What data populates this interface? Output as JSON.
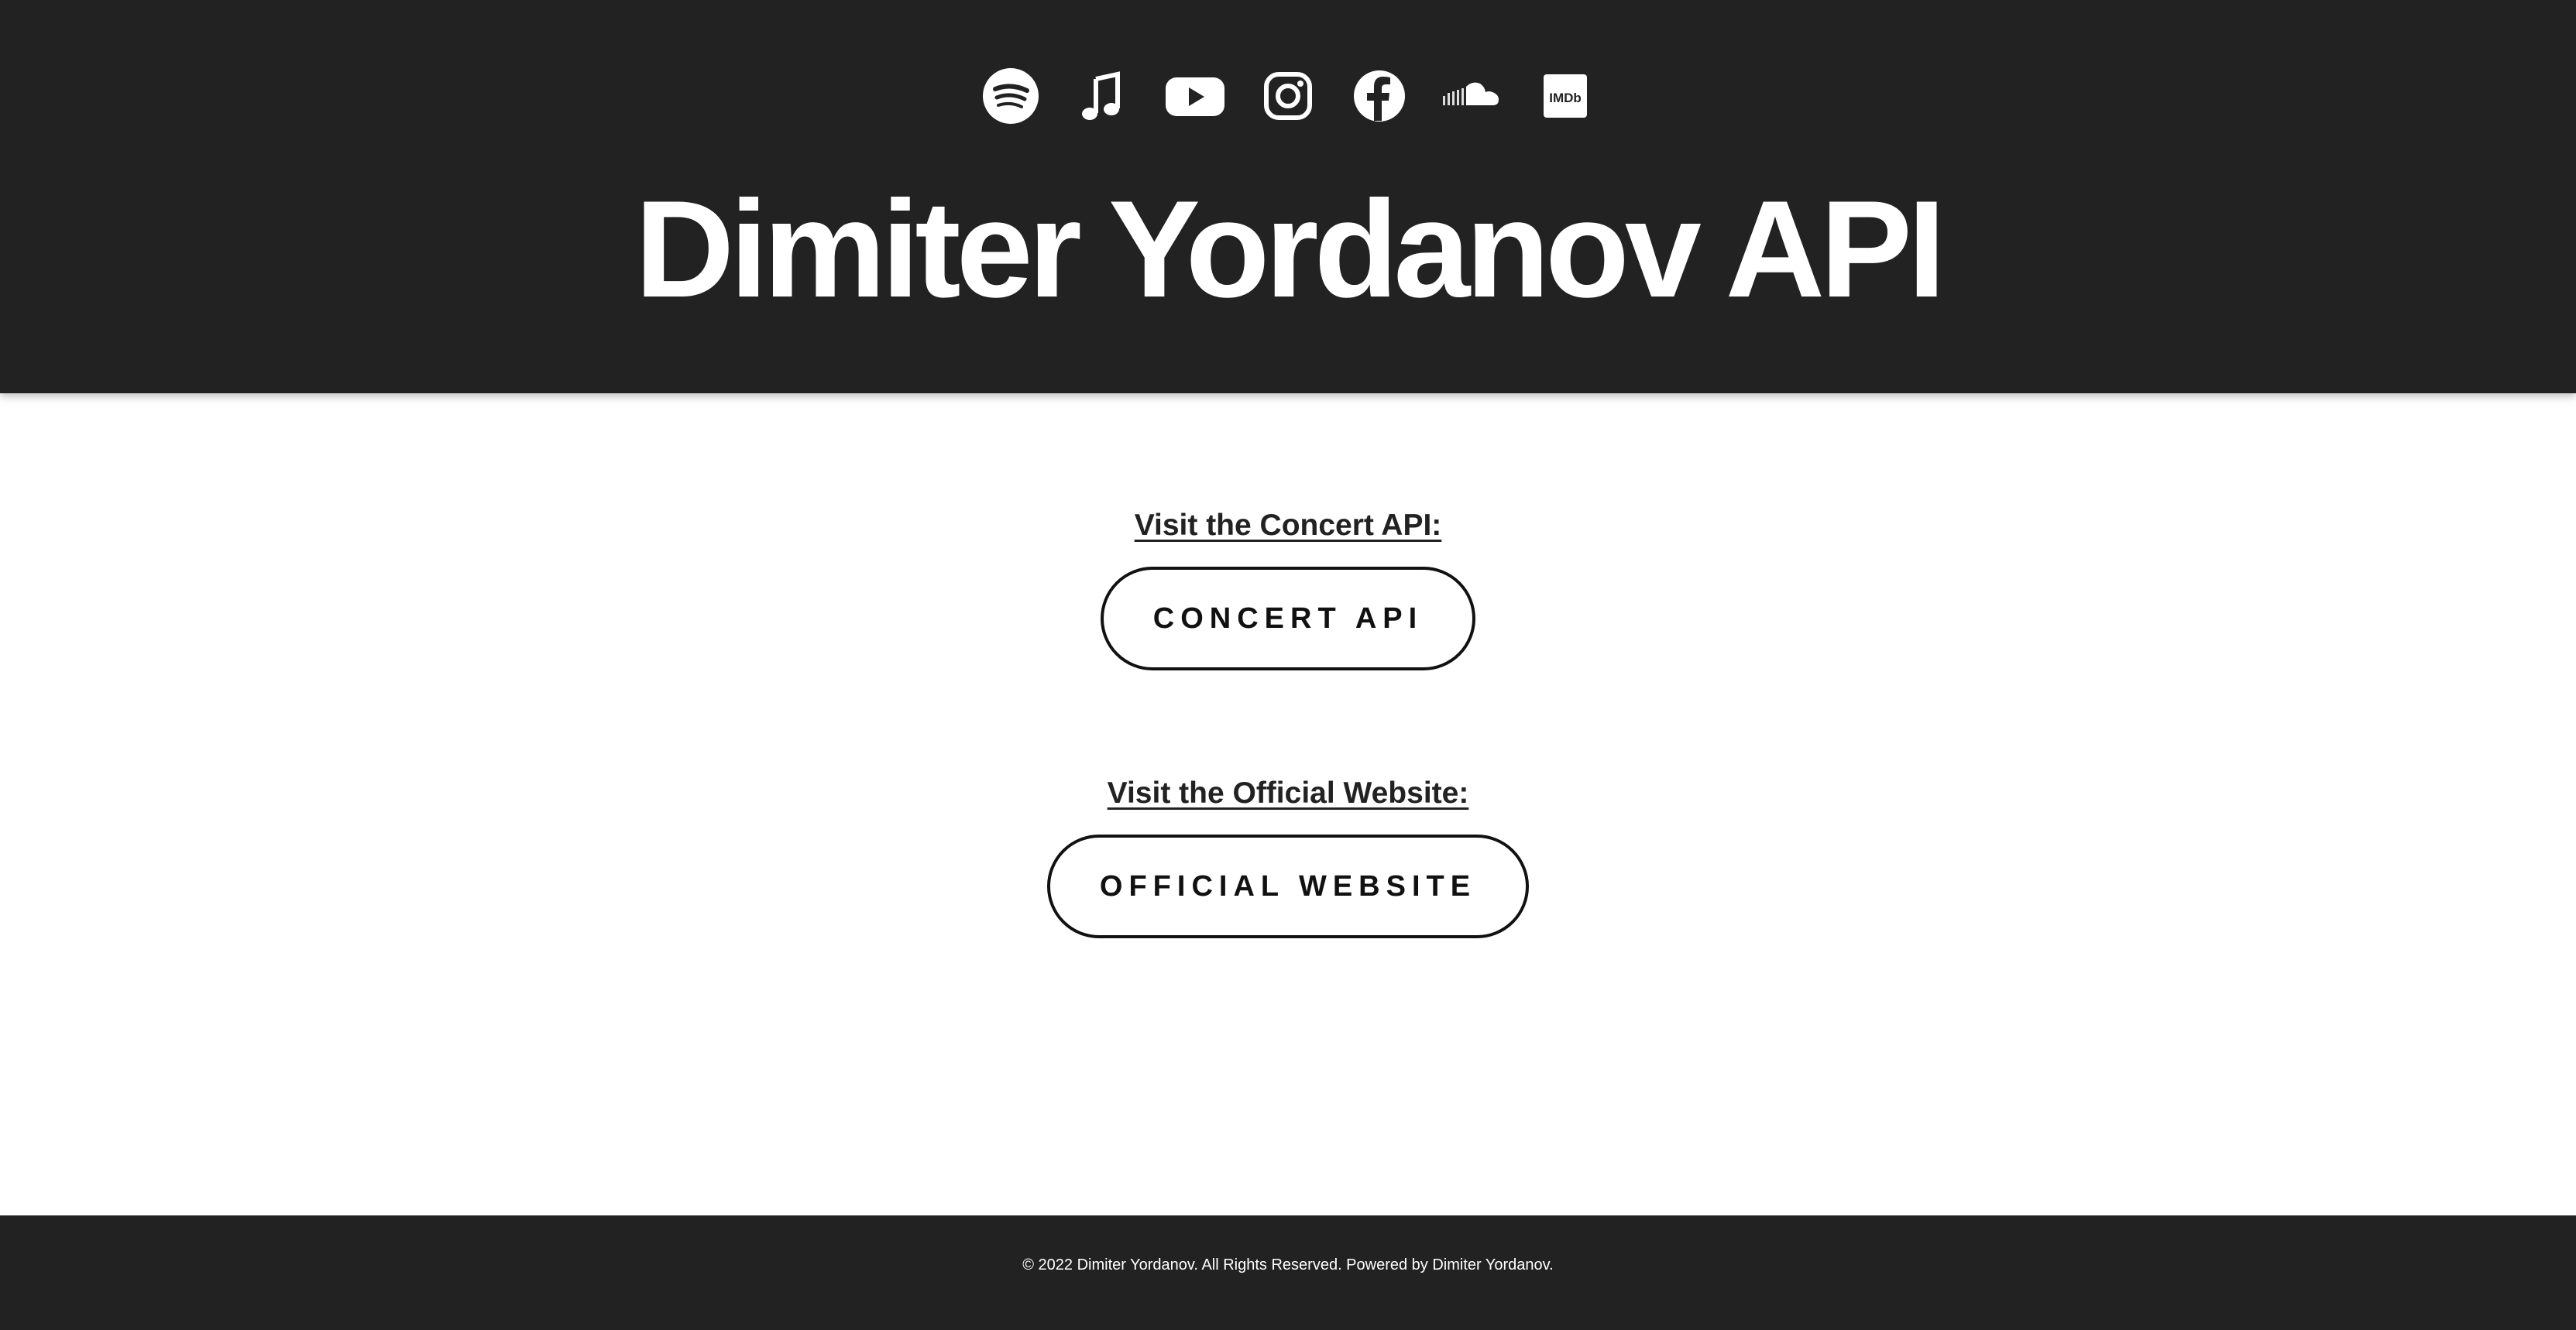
{
  "header": {
    "title": "Dimiter Yordanov API",
    "social_icons": [
      {
        "name": "spotify-icon"
      },
      {
        "name": "apple-music-icon"
      },
      {
        "name": "youtube-icon"
      },
      {
        "name": "instagram-icon"
      },
      {
        "name": "facebook-icon"
      },
      {
        "name": "soundcloud-icon"
      },
      {
        "name": "imdb-icon",
        "label": "IMDb"
      }
    ]
  },
  "main": {
    "concert": {
      "heading": "Visit the Concert API:",
      "button_label": "CONCERT API"
    },
    "official": {
      "heading": "Visit the Official Website:",
      "button_label": "OFFICIAL WEBSITE"
    }
  },
  "footer": {
    "text": "© 2022 Dimiter Yordanov. All Rights Reserved. Powered by Dimiter Yordanov."
  },
  "colors": {
    "header_bg": "#222222",
    "footer_bg": "#222222",
    "text_dark": "#222222",
    "text_light": "#ffffff",
    "button_border": "#111111"
  }
}
